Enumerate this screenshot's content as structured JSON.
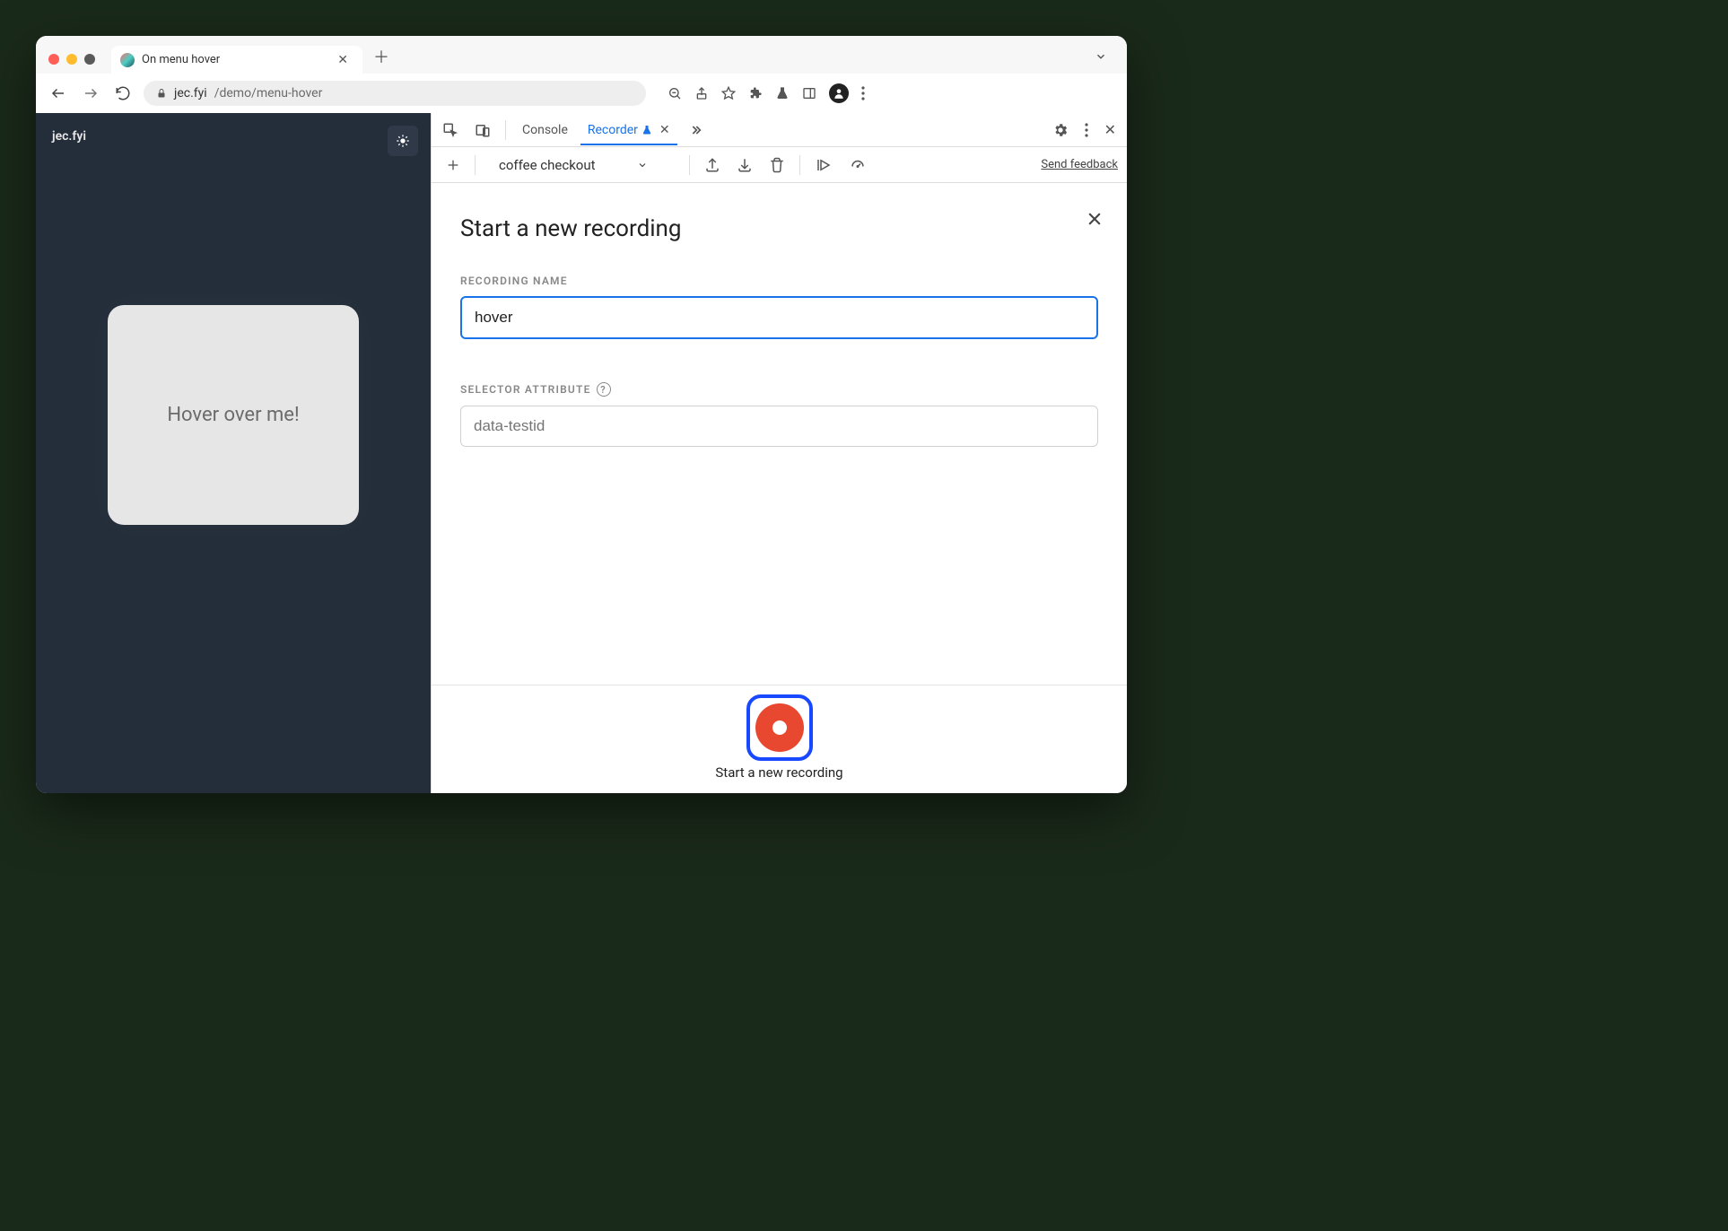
{
  "window": {
    "tab_title": "On menu hover",
    "url_host": "jec.fyi",
    "url_path": "/demo/menu-hover"
  },
  "page": {
    "brand": "jec.fyi",
    "card_text": "Hover over me!"
  },
  "devtools": {
    "tabs": {
      "console": "Console",
      "recorder": "Recorder"
    },
    "toolbar": {
      "dropdown_value": "coffee checkout",
      "feedback_link": "Send feedback"
    },
    "panel": {
      "title": "Start a new recording",
      "recording_name_label": "RECORDING NAME",
      "recording_name_value": "hover",
      "selector_attr_label": "SELECTOR ATTRIBUTE",
      "selector_attr_placeholder": "data-testid",
      "record_button_label": "Start a new recording"
    }
  }
}
